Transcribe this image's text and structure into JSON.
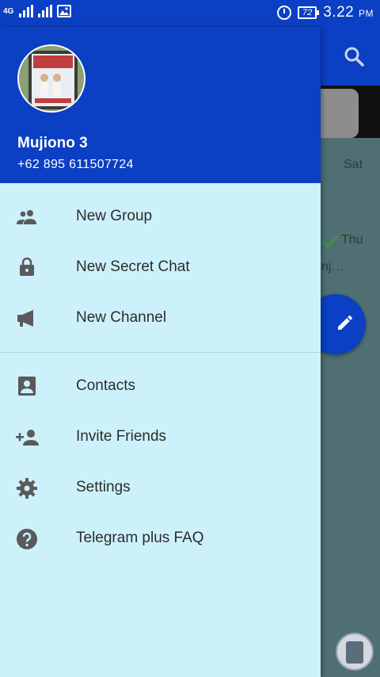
{
  "status_bar": {
    "network": "4G",
    "battery": "72",
    "time": "3.22",
    "ampm": "PM"
  },
  "drawer": {
    "profile": {
      "name": "Mujiono 3",
      "phone": "+62 895 611507724"
    },
    "menu": [
      {
        "label": "New Group",
        "icon": "group-icon"
      },
      {
        "label": "New Secret Chat",
        "icon": "lock-icon"
      },
      {
        "label": "New Channel",
        "icon": "megaphone-icon"
      },
      {
        "label": "Contacts",
        "icon": "contact-icon"
      },
      {
        "label": "Invite Friends",
        "icon": "add-person-icon"
      },
      {
        "label": "Settings",
        "icon": "gear-icon"
      },
      {
        "label": "Telegram plus FAQ",
        "icon": "help-icon"
      }
    ]
  },
  "background": {
    "chat_date_1": "Sat",
    "chat_date_2": "Thu",
    "chat_snippet": "nj…"
  },
  "colors": {
    "header": "#0b3fc4",
    "drawer": "#cdf1fb",
    "icon": "#5a5a5a"
  }
}
